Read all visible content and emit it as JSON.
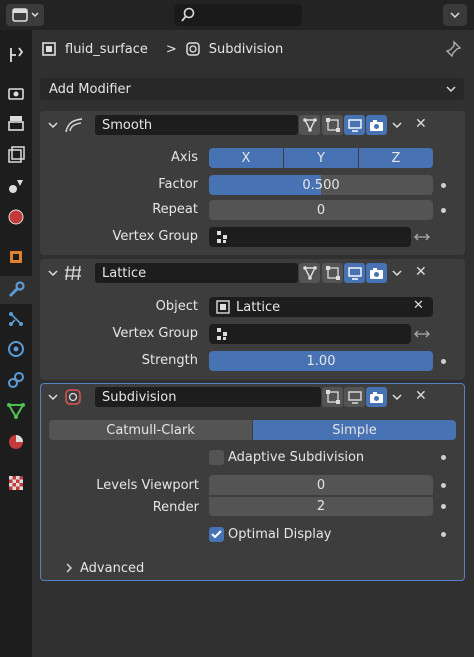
{
  "header": {
    "search_placeholder": "",
    "editor_icon": "properties-editor-icon",
    "options_icon": "options-chevron-icon"
  },
  "breadcrumb": {
    "object": "fluid_surface",
    "separator": ">",
    "modifier": "Subdivision"
  },
  "add_modifier": {
    "label": "Add Modifier"
  },
  "sidebar": {
    "items": [
      "tool",
      "render",
      "output",
      "view-layer",
      "scene",
      "world",
      "object",
      "modifiers",
      "particles",
      "physics",
      "constraints",
      "data",
      "material",
      "texture"
    ],
    "active": "modifiers"
  },
  "modifiers": [
    {
      "name": "Smooth",
      "axis_label": "Axis",
      "axes": [
        "X",
        "Y",
        "Z"
      ],
      "factor_label": "Factor",
      "factor": "0.500",
      "repeat_label": "Repeat",
      "repeat": "0",
      "vertex_group_label": "Vertex Group",
      "vertex_group": ""
    },
    {
      "name": "Lattice",
      "object_label": "Object",
      "object": "Lattice",
      "vertex_group_label": "Vertex Group",
      "vertex_group": "",
      "strength_label": "Strength",
      "strength": "1.00"
    },
    {
      "name": "Subdivision",
      "modes": [
        "Catmull-Clark",
        "Simple"
      ],
      "active_mode": "Simple",
      "adaptive_label": "Adaptive Subdivision",
      "adaptive_checked": false,
      "levels_viewport_label": "Levels Viewport",
      "levels_viewport": "0",
      "render_label": "Render",
      "render": "2",
      "optimal_label": "Optimal Display",
      "optimal_checked": true,
      "advanced_label": "Advanced"
    }
  ],
  "colors": {
    "accent": "#4772b3",
    "bg": "#303030",
    "panel": "#3d3d3d",
    "field": "#545454",
    "dark_field": "#1d1d1d"
  }
}
